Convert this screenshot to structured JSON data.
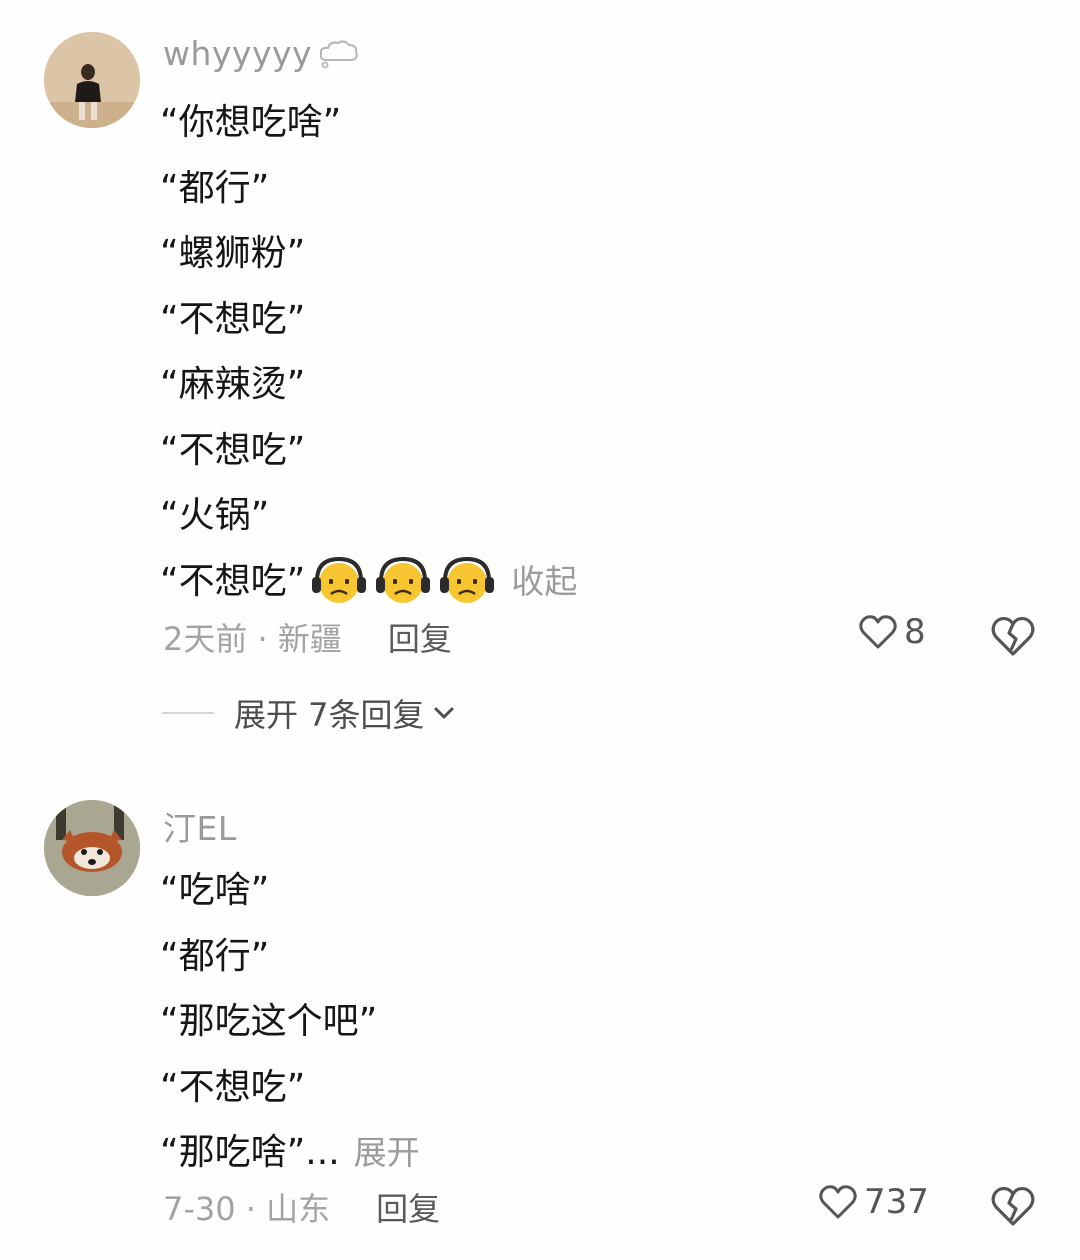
{
  "comments": [
    {
      "username": "whyyyyy",
      "username_icon": "thought-bubble-icon",
      "lines": [
        "“你想吃啥”",
        "“都行”",
        "“螺狮粉”",
        "“不想吃”",
        "“麻辣烫”",
        "“不想吃”",
        "“火锅”",
        "“不想吃”"
      ],
      "emojis": [
        "headphones-frown-emoji",
        "headphones-frown-emoji",
        "headphones-frown-emoji"
      ],
      "collapse_label": "收起",
      "time_location": "2天前 · 新疆",
      "reply_label": "回复",
      "like_count": "8",
      "expand_replies_label": "展开 7条回复"
    },
    {
      "username": "汀EL",
      "lines": [
        "“吃啥”",
        "“都行”",
        "“那吃这个吧”",
        "“不想吃”",
        "“那吃啥”..."
      ],
      "expand_label": "展开",
      "time_location": "7-30 · 山东",
      "reply_label": "回复",
      "like_count": "737"
    }
  ],
  "colors": {
    "text": "#161616",
    "meta": "#a3a3a3",
    "reply": "#5a5a5a",
    "emoji_face": "#f7c52f",
    "headphones": "#2b2b2b"
  }
}
